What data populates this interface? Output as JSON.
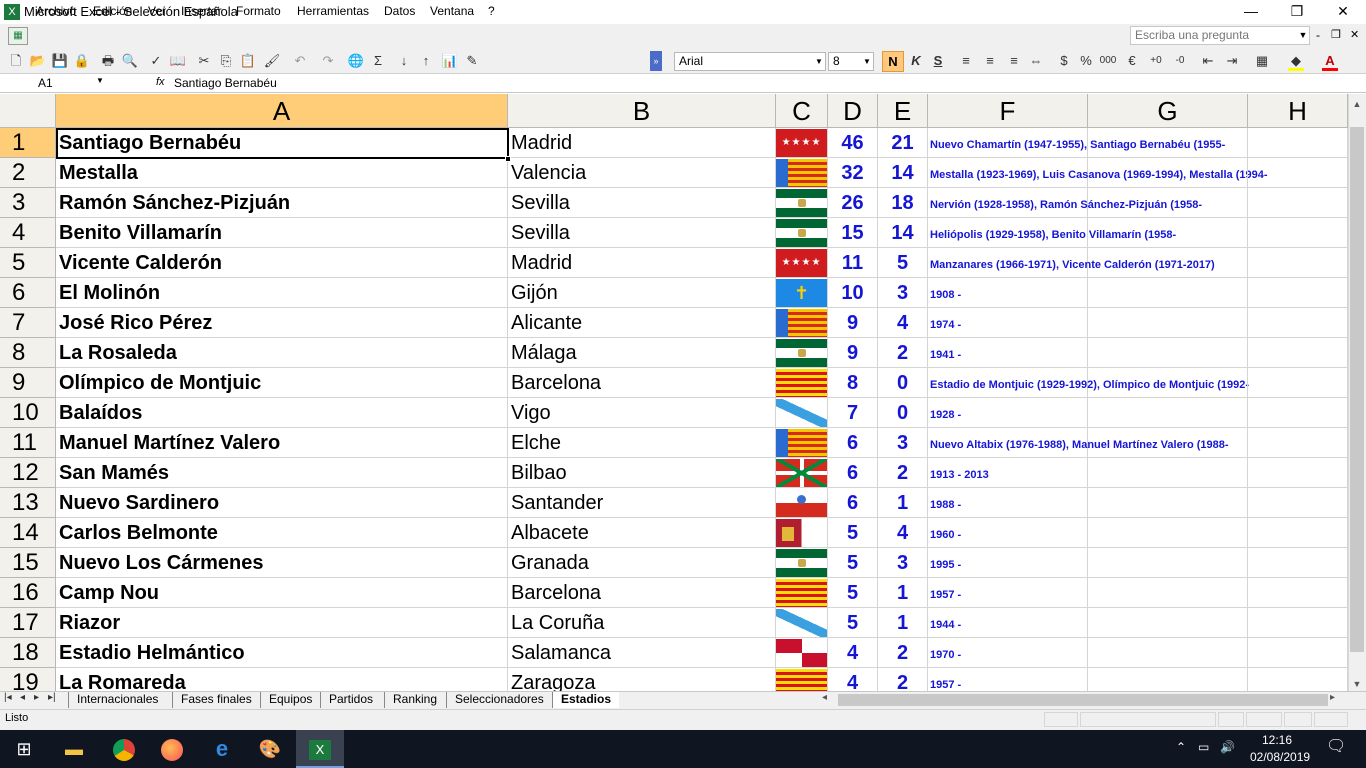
{
  "window": {
    "title": "Microsoft Excel - Selección Española",
    "minimize": "—",
    "maximize": "❐",
    "close": "✕"
  },
  "menu": {
    "items": [
      "Archivo",
      "Edición",
      "Ver",
      "Insertar",
      "Formato",
      "Herramientas",
      "Datos",
      "Ventana",
      "?"
    ],
    "ask_placeholder": "Escriba una pregunta"
  },
  "format": {
    "font": "Arial",
    "size": "8",
    "bold": "N",
    "italic": "K",
    "underline": "S"
  },
  "formula_bar": {
    "name_box": "A1",
    "fx": "fx",
    "content": "Santiago Bernabéu"
  },
  "columns": [
    "A",
    "B",
    "C",
    "D",
    "E",
    "F",
    "G",
    "H"
  ],
  "rows": [
    {
      "n": "1",
      "name": "Santiago Bernabéu",
      "city": "Madrid",
      "flag": "madrid",
      "d": "46",
      "e": "21",
      "f": "Nuevo Chamartín (1947-1955), Santiago Bernabéu (1955-"
    },
    {
      "n": "2",
      "name": "Mestalla",
      "city": "Valencia",
      "flag": "valencia",
      "d": "32",
      "e": "14",
      "f": "Mestalla (1923-1969), Luis Casanova (1969-1994), Mestalla (1994-"
    },
    {
      "n": "3",
      "name": "Ramón Sánchez-Pizjuán",
      "city": "Sevilla",
      "flag": "andalucia",
      "d": "26",
      "e": "18",
      "f": "Nervión (1928-1958), Ramón Sánchez-Pizjuán (1958-"
    },
    {
      "n": "4",
      "name": "Benito Villamarín",
      "city": "Sevilla",
      "flag": "andalucia",
      "d": "15",
      "e": "14",
      "f": "Heliópolis (1929-1958), Benito Villamarín (1958-"
    },
    {
      "n": "5",
      "name": "Vicente Calderón",
      "city": "Madrid",
      "flag": "madrid",
      "d": "11",
      "e": "5",
      "f": "Manzanares (1966-1971), Vicente Calderón (1971-2017)"
    },
    {
      "n": "6",
      "name": "El Molinón",
      "city": "Gijón",
      "flag": "asturias",
      "d": "10",
      "e": "3",
      "f": "1908 -"
    },
    {
      "n": "7",
      "name": "José Rico Pérez",
      "city": "Alicante",
      "flag": "valencia",
      "d": "9",
      "e": "4",
      "f": "1974 -"
    },
    {
      "n": "8",
      "name": "La Rosaleda",
      "city": "Málaga",
      "flag": "andalucia",
      "d": "9",
      "e": "2",
      "f": "1941 -"
    },
    {
      "n": "9",
      "name": "Olímpico de Montjuic",
      "city": "Barcelona",
      "flag": "cataluna",
      "d": "8",
      "e": "0",
      "f": "Estadio de Montjuic (1929-1992), Olímpico de Montjuic (1992-"
    },
    {
      "n": "10",
      "name": "Balaídos",
      "city": "Vigo",
      "flag": "galicia",
      "d": "7",
      "e": "0",
      "f": "1928 -"
    },
    {
      "n": "11",
      "name": "Manuel Martínez Valero",
      "city": "Elche",
      "flag": "valencia",
      "d": "6",
      "e": "3",
      "f": "Nuevo Altabix (1976-1988), Manuel Martínez Valero (1988-"
    },
    {
      "n": "12",
      "name": "San Mamés",
      "city": "Bilbao",
      "flag": "euskadi",
      "d": "6",
      "e": "2",
      "f": "1913 - 2013"
    },
    {
      "n": "13",
      "name": "Nuevo Sardinero",
      "city": "Santander",
      "flag": "cantabria",
      "d": "6",
      "e": "1",
      "f": "1988 -"
    },
    {
      "n": "14",
      "name": "Carlos Belmonte",
      "city": "Albacete",
      "flag": "castillalamancha",
      "d": "5",
      "e": "4",
      "f": "1960 -"
    },
    {
      "n": "15",
      "name": "Nuevo Los Cármenes",
      "city": "Granada",
      "flag": "andalucia",
      "d": "5",
      "e": "3",
      "f": "1995 -"
    },
    {
      "n": "16",
      "name": "Camp Nou",
      "city": "Barcelona",
      "flag": "cataluna",
      "d": "5",
      "e": "1",
      "f": "1957 -"
    },
    {
      "n": "17",
      "name": "Riazor",
      "city": "La Coruña",
      "flag": "galicia",
      "d": "5",
      "e": "1",
      "f": "1944 -"
    },
    {
      "n": "18",
      "name": "Estadio Helmántico",
      "city": "Salamanca",
      "flag": "castillaleon",
      "d": "4",
      "e": "2",
      "f": "1970 -"
    },
    {
      "n": "19",
      "name": "La Romareda",
      "city": "Zaragoza",
      "flag": "aragon",
      "d": "4",
      "e": "2",
      "f": "1957 -"
    }
  ],
  "sheets": [
    "Internacionales",
    "Fases finales",
    "Equipos",
    "Partidos",
    "Ranking",
    "Seleccionadores",
    "Estadios"
  ],
  "active_sheet": "Estadios",
  "status": "Listo",
  "clock": {
    "time": "12:16",
    "date": "02/08/2019"
  },
  "colors": {
    "accent_header": "#ffcc77",
    "blue_text": "#1515d6"
  }
}
